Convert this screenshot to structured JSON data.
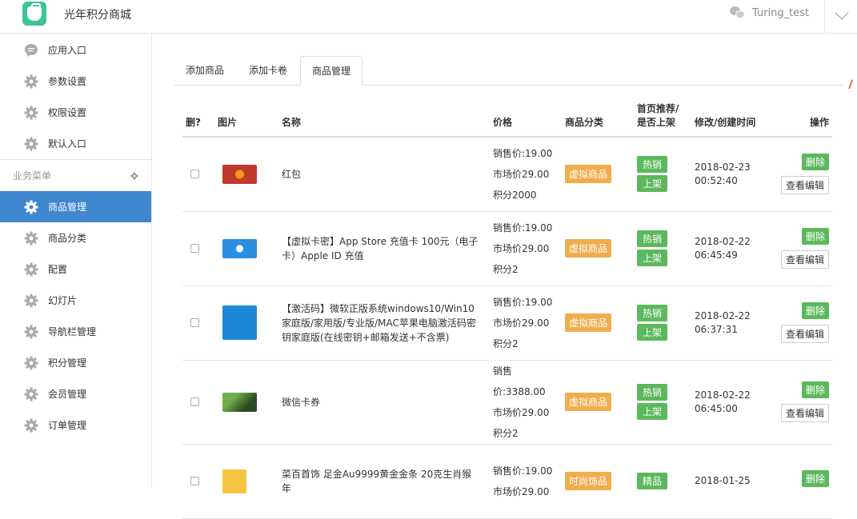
{
  "header": {
    "app_title": "光年积分商城",
    "username": "Turing_test"
  },
  "sidebar": {
    "top_items": [
      {
        "label": "应用入口",
        "icon": "chat-icon"
      },
      {
        "label": "参数设置",
        "icon": "gear-icon"
      },
      {
        "label": "权限设置",
        "icon": "gear-icon"
      },
      {
        "label": "默认入口",
        "icon": "gear-icon"
      }
    ],
    "section_label": "业务菜单",
    "menu_items": [
      {
        "label": "商品管理",
        "active": true
      },
      {
        "label": "商品分类"
      },
      {
        "label": "配置"
      },
      {
        "label": "幻灯片"
      },
      {
        "label": "导航栏管理"
      },
      {
        "label": "积分管理"
      },
      {
        "label": "会员管理"
      },
      {
        "label": "订单管理"
      }
    ]
  },
  "tabs": [
    {
      "label": "添加商品"
    },
    {
      "label": "添加卡卷"
    },
    {
      "label": "商品管理",
      "active": true
    }
  ],
  "table": {
    "headers": {
      "del": "删?",
      "image": "图片",
      "name": "名称",
      "price": "价格",
      "category": "商品分类",
      "recommend_line1": "首页推荐/",
      "recommend_line2": "是否上架",
      "time": "修改/创建时间",
      "ops": "操作"
    },
    "rows": [
      {
        "name": "红包",
        "sale_price": "销售价:19.00",
        "market_price": "市场价29.00",
        "points": "积分2000",
        "category": "虚拟商品",
        "recommend": "热销",
        "status": "上架",
        "date": "2018-02-23",
        "clock": "00:52:40",
        "delete": "删除",
        "edit": "查看编辑"
      },
      {
        "name": "【虚拟卡密】App Store 充值卡 100元（电子卡）Apple ID 充值",
        "sale_price": "销售价:19.00",
        "market_price": "市场价29.00",
        "points": "积分2",
        "category": "虚拟商品",
        "recommend": "热销",
        "status": "上架",
        "date": "2018-02-22",
        "clock": "06:45:49",
        "delete": "删除",
        "edit": "查看编辑"
      },
      {
        "name": "【激活码】微软正版系统windows10/Win10家庭版/家用版/专业版/MAC苹果电脑激活码密钥家庭版(在线密钥+邮箱发送+不含票)",
        "sale_price": "销售价:19.00",
        "market_price": "市场价29.00",
        "points": "积分2",
        "category": "虚拟商品",
        "recommend": "热销",
        "status": "上架",
        "date": "2018-02-22",
        "clock": "06:37:31",
        "delete": "删除",
        "edit": "查看编辑"
      },
      {
        "name": "微信卡券",
        "sale_price": "销售价:3388.00",
        "market_price": "市场价29.00",
        "points": "积分2",
        "category": "虚拟商品",
        "recommend": "热销",
        "status": "上架",
        "date": "2018-02-22",
        "clock": "06:45:00",
        "delete": "删除",
        "edit": "查看编辑"
      },
      {
        "name": "菜百首饰 足金Au9999黄金金条 20克生肖猴年",
        "sale_price": "销售价:19.00",
        "market_price": "市场价29.00",
        "points": "",
        "category": "时尚饰品",
        "recommend": "精品",
        "status": "",
        "date": "2018-01-25",
        "clock": "",
        "delete": "删除",
        "edit": ""
      }
    ]
  },
  "colors": {
    "brand": "#3ec39a",
    "active_nav": "#3f87ce",
    "tag_orange": "#f0ad4e",
    "btn_green": "#5cb85c"
  }
}
